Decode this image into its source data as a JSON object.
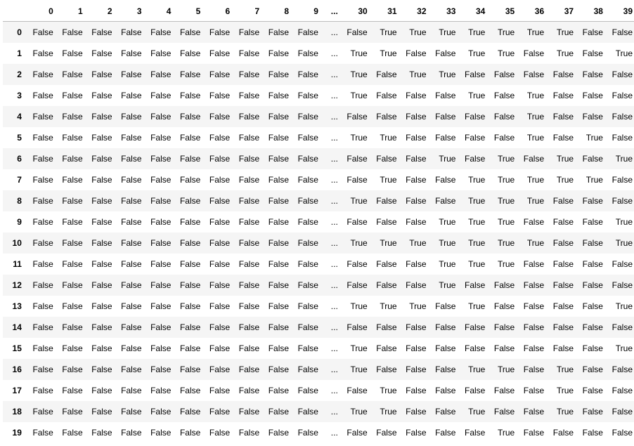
{
  "table": {
    "columns": [
      "0",
      "1",
      "2",
      "3",
      "4",
      "5",
      "6",
      "7",
      "8",
      "9",
      "...",
      "30",
      "31",
      "32",
      "33",
      "34",
      "35",
      "36",
      "37",
      "38",
      "39"
    ],
    "rows": [
      {
        "index": "0",
        "cells": [
          "False",
          "False",
          "False",
          "False",
          "False",
          "False",
          "False",
          "False",
          "False",
          "False",
          "...",
          "False",
          "True",
          "True",
          "True",
          "True",
          "True",
          "True",
          "True",
          "False",
          "False"
        ]
      },
      {
        "index": "1",
        "cells": [
          "False",
          "False",
          "False",
          "False",
          "False",
          "False",
          "False",
          "False",
          "False",
          "False",
          "...",
          "True",
          "True",
          "False",
          "False",
          "True",
          "True",
          "False",
          "True",
          "False",
          "True"
        ]
      },
      {
        "index": "2",
        "cells": [
          "False",
          "False",
          "False",
          "False",
          "False",
          "False",
          "False",
          "False",
          "False",
          "False",
          "...",
          "True",
          "False",
          "True",
          "True",
          "False",
          "False",
          "False",
          "False",
          "False",
          "False"
        ]
      },
      {
        "index": "3",
        "cells": [
          "False",
          "False",
          "False",
          "False",
          "False",
          "False",
          "False",
          "False",
          "False",
          "False",
          "...",
          "True",
          "False",
          "False",
          "False",
          "True",
          "False",
          "True",
          "False",
          "False",
          "False"
        ]
      },
      {
        "index": "4",
        "cells": [
          "False",
          "False",
          "False",
          "False",
          "False",
          "False",
          "False",
          "False",
          "False",
          "False",
          "...",
          "False",
          "False",
          "False",
          "False",
          "False",
          "False",
          "True",
          "False",
          "False",
          "False"
        ]
      },
      {
        "index": "5",
        "cells": [
          "False",
          "False",
          "False",
          "False",
          "False",
          "False",
          "False",
          "False",
          "False",
          "False",
          "...",
          "True",
          "True",
          "False",
          "False",
          "False",
          "False",
          "True",
          "False",
          "True",
          "False"
        ]
      },
      {
        "index": "6",
        "cells": [
          "False",
          "False",
          "False",
          "False",
          "False",
          "False",
          "False",
          "False",
          "False",
          "False",
          "...",
          "False",
          "False",
          "False",
          "True",
          "False",
          "True",
          "False",
          "True",
          "False",
          "True"
        ]
      },
      {
        "index": "7",
        "cells": [
          "False",
          "False",
          "False",
          "False",
          "False",
          "False",
          "False",
          "False",
          "False",
          "False",
          "...",
          "False",
          "True",
          "False",
          "False",
          "True",
          "True",
          "True",
          "True",
          "True",
          "False"
        ]
      },
      {
        "index": "8",
        "cells": [
          "False",
          "False",
          "False",
          "False",
          "False",
          "False",
          "False",
          "False",
          "False",
          "False",
          "...",
          "True",
          "False",
          "False",
          "False",
          "True",
          "True",
          "True",
          "False",
          "False",
          "False"
        ]
      },
      {
        "index": "9",
        "cells": [
          "False",
          "False",
          "False",
          "False",
          "False",
          "False",
          "False",
          "False",
          "False",
          "False",
          "...",
          "False",
          "False",
          "False",
          "True",
          "True",
          "True",
          "False",
          "False",
          "False",
          "True"
        ]
      },
      {
        "index": "10",
        "cells": [
          "False",
          "False",
          "False",
          "False",
          "False",
          "False",
          "False",
          "False",
          "False",
          "False",
          "...",
          "True",
          "True",
          "True",
          "True",
          "True",
          "True",
          "True",
          "False",
          "False",
          "True"
        ]
      },
      {
        "index": "11",
        "cells": [
          "False",
          "False",
          "False",
          "False",
          "False",
          "False",
          "False",
          "False",
          "False",
          "False",
          "...",
          "False",
          "False",
          "False",
          "True",
          "True",
          "True",
          "False",
          "False",
          "False",
          "False"
        ]
      },
      {
        "index": "12",
        "cells": [
          "False",
          "False",
          "False",
          "False",
          "False",
          "False",
          "False",
          "False",
          "False",
          "False",
          "...",
          "False",
          "False",
          "False",
          "True",
          "False",
          "False",
          "False",
          "False",
          "False",
          "False"
        ]
      },
      {
        "index": "13",
        "cells": [
          "False",
          "False",
          "False",
          "False",
          "False",
          "False",
          "False",
          "False",
          "False",
          "False",
          "...",
          "True",
          "True",
          "True",
          "False",
          "True",
          "False",
          "False",
          "False",
          "False",
          "True"
        ]
      },
      {
        "index": "14",
        "cells": [
          "False",
          "False",
          "False",
          "False",
          "False",
          "False",
          "False",
          "False",
          "False",
          "False",
          "...",
          "False",
          "False",
          "False",
          "False",
          "False",
          "False",
          "False",
          "False",
          "False",
          "False"
        ]
      },
      {
        "index": "15",
        "cells": [
          "False",
          "False",
          "False",
          "False",
          "False",
          "False",
          "False",
          "False",
          "False",
          "False",
          "...",
          "True",
          "False",
          "False",
          "False",
          "False",
          "False",
          "False",
          "False",
          "False",
          "True"
        ]
      },
      {
        "index": "16",
        "cells": [
          "False",
          "False",
          "False",
          "False",
          "False",
          "False",
          "False",
          "False",
          "False",
          "False",
          "...",
          "True",
          "False",
          "False",
          "False",
          "True",
          "True",
          "False",
          "True",
          "False",
          "False"
        ]
      },
      {
        "index": "17",
        "cells": [
          "False",
          "False",
          "False",
          "False",
          "False",
          "False",
          "False",
          "False",
          "False",
          "False",
          "...",
          "False",
          "True",
          "False",
          "False",
          "False",
          "False",
          "False",
          "True",
          "False",
          "False"
        ]
      },
      {
        "index": "18",
        "cells": [
          "False",
          "False",
          "False",
          "False",
          "False",
          "False",
          "False",
          "False",
          "False",
          "False",
          "...",
          "True",
          "True",
          "False",
          "False",
          "True",
          "False",
          "False",
          "True",
          "False",
          "False"
        ]
      },
      {
        "index": "19",
        "cells": [
          "False",
          "False",
          "False",
          "False",
          "False",
          "False",
          "False",
          "False",
          "False",
          "False",
          "...",
          "False",
          "False",
          "False",
          "False",
          "False",
          "True",
          "False",
          "False",
          "False",
          "False"
        ]
      }
    ]
  }
}
